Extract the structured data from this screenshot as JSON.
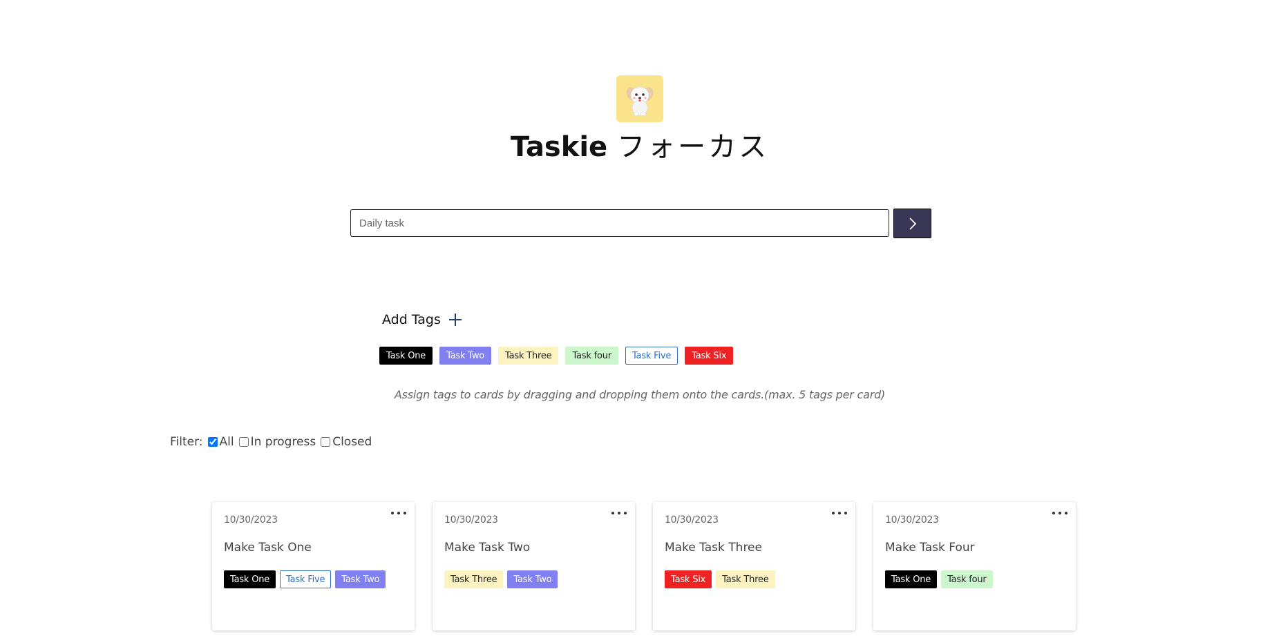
{
  "app": {
    "title_bold": "Taskie",
    "title_jp": "フォーカス",
    "logo_icon": "puppy-logo-icon",
    "logo_bg": "#fbe38c"
  },
  "input": {
    "placeholder": "Daily task",
    "value": ""
  },
  "submit_icon": "chevron-right-icon",
  "tags_section": {
    "add_label": "Add Tags",
    "add_icon": "plus-icon",
    "hint": "Assign tags to cards by dragging and dropping them onto the cards.(max. 5 tags per card)",
    "tags": [
      {
        "label": "Task One",
        "bg": "#000000",
        "fg": "#ffffff",
        "border": "#000000"
      },
      {
        "label": "Task Two",
        "bg": "#8080f0",
        "fg": "#ffffff",
        "border": "#8080f0"
      },
      {
        "label": "Task Three",
        "bg": "#fdf3c0",
        "fg": "#222222",
        "border": "#fdf3c0"
      },
      {
        "label": "Task four",
        "bg": "#ccf7cc",
        "fg": "#222222",
        "border": "#ccf7cc"
      },
      {
        "label": "Task Five",
        "bg": "#ffffff",
        "fg": "#2f6fbf",
        "border": "#2f6fbf"
      },
      {
        "label": "Task Six",
        "bg": "#ee2222",
        "fg": "#ffffff",
        "border": "#ee2222"
      }
    ]
  },
  "filter": {
    "label": "Filter:",
    "options": [
      {
        "label": "All",
        "checked": true
      },
      {
        "label": "In progress",
        "checked": false
      },
      {
        "label": "Closed",
        "checked": false
      }
    ]
  },
  "cards": [
    {
      "date": "10/30/2023",
      "name": "Make Task One",
      "tags": [
        "Task One",
        "Task Five",
        "Task Two"
      ]
    },
    {
      "date": "10/30/2023",
      "name": "Make Task Two",
      "tags": [
        "Task Three",
        "Task Two"
      ]
    },
    {
      "date": "10/30/2023",
      "name": "Make Task Three",
      "tags": [
        "Task Six",
        "Task Three"
      ]
    },
    {
      "date": "10/30/2023",
      "name": "Make Task Four",
      "tags": [
        "Task One",
        "Task four"
      ]
    }
  ]
}
